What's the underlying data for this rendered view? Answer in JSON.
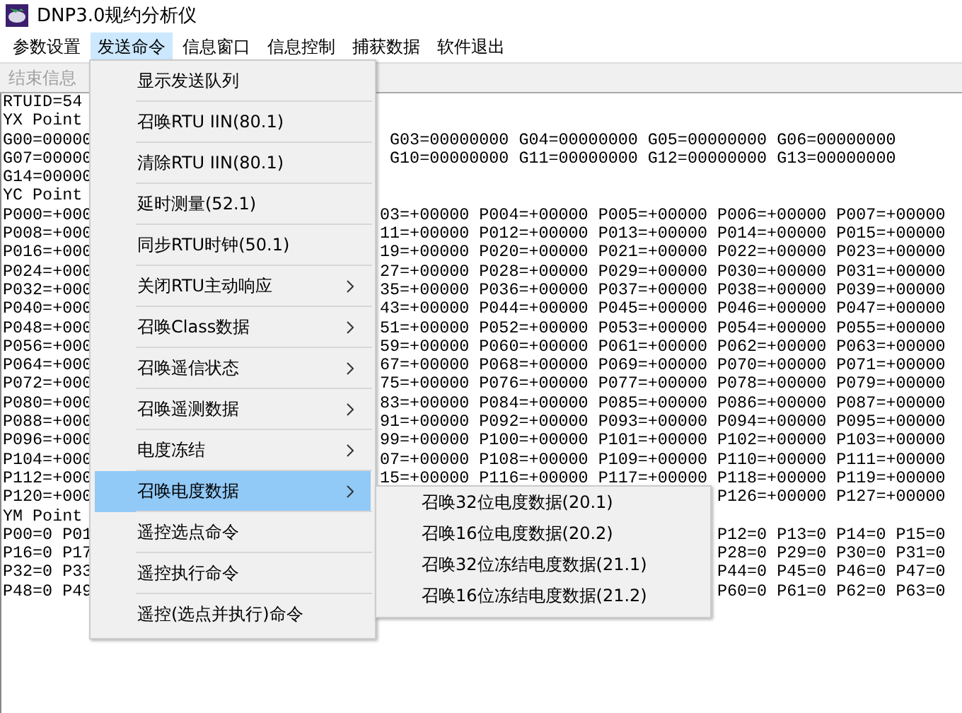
{
  "window": {
    "title": "DNP3.0规约分析仪"
  },
  "menu_bar": [
    {
      "label": "参数设置",
      "selected": false
    },
    {
      "label": "发送命令",
      "selected": true
    },
    {
      "label": "信息窗口",
      "selected": false
    },
    {
      "label": "信息控制",
      "selected": false
    },
    {
      "label": "捕获数据",
      "selected": false
    },
    {
      "label": "软件退出",
      "selected": false
    }
  ],
  "toolbar": [
    {
      "label": "结束信息",
      "disabled": true
    }
  ],
  "console_lines": [
    {
      "left": "RTUID=54"
    },
    {
      "left": "YX Point"
    },
    {
      "left": "G00=00000",
      "right": "G03=00000000 G04=00000000 G05=00000000 G06=00000000"
    },
    {
      "left": "G07=00000",
      "right": "G10=00000000 G11=00000000 G12=00000000 G13=00000000"
    },
    {
      "left": "G14=00000"
    },
    {
      "left": "YC Point"
    },
    {
      "left": "P000=+000",
      "right": "03=+00000 P004=+00000 P005=+00000 P006=+00000 P007=+00000"
    },
    {
      "left": "P008=+000",
      "right": "11=+00000 P012=+00000 P013=+00000 P014=+00000 P015=+00000"
    },
    {
      "left": "P016=+000",
      "right": "19=+00000 P020=+00000 P021=+00000 P022=+00000 P023=+00000"
    },
    {
      "left": "P024=+000",
      "right": "27=+00000 P028=+00000 P029=+00000 P030=+00000 P031=+00000"
    },
    {
      "left": "P032=+000",
      "right": "35=+00000 P036=+00000 P037=+00000 P038=+00000 P039=+00000"
    },
    {
      "left": "P040=+000",
      "right": "43=+00000 P044=+00000 P045=+00000 P046=+00000 P047=+00000"
    },
    {
      "left": "P048=+000",
      "right": "51=+00000 P052=+00000 P053=+00000 P054=+00000 P055=+00000"
    },
    {
      "left": "P056=+000",
      "right": "59=+00000 P060=+00000 P061=+00000 P062=+00000 P063=+00000"
    },
    {
      "left": "P064=+000",
      "right": "67=+00000 P068=+00000 P069=+00000 P070=+00000 P071=+00000"
    },
    {
      "left": "P072=+000",
      "right": "75=+00000 P076=+00000 P077=+00000 P078=+00000 P079=+00000"
    },
    {
      "left": "P080=+000",
      "right": "83=+00000 P084=+00000 P085=+00000 P086=+00000 P087=+00000"
    },
    {
      "left": "P088=+000",
      "right": "91=+00000 P092=+00000 P093=+00000 P094=+00000 P095=+00000"
    },
    {
      "left": "P096=+000",
      "right": "99=+00000 P100=+00000 P101=+00000 P102=+00000 P103=+00000"
    },
    {
      "left": "P104=+000",
      "right": "07=+00000 P108=+00000 P109=+00000 P110=+00000 P111=+00000"
    },
    {
      "left": "P112=+000",
      "right": "15=+00000 P116=+00000 P117=+00000 P118=+00000 P119=+00000"
    },
    {
      "left": "P120=+000",
      "right": "P126=+00000 P127=+00000"
    },
    {
      "left": "YM Point"
    },
    {
      "left": "P00=0 P01",
      "right": "P12=0 P13=0 P14=0 P15=0"
    },
    {
      "left": "P16=0 P17",
      "right": "P28=0 P29=0 P30=0 P31=0"
    },
    {
      "left": "P32=0 P33",
      "right": "P44=0 P45=0 P46=0 P47=0"
    },
    {
      "left": "P48=0 P49",
      "right": "P60=0 P61=0 P62=0 P63=0"
    }
  ],
  "dropdown_menu": [
    {
      "label": "显示发送队列",
      "has_submenu": false,
      "selected": false
    },
    {
      "label": "召唤RTU IIN(80.1)",
      "has_submenu": false,
      "selected": false
    },
    {
      "label": "清除RTU IIN(80.1)",
      "has_submenu": false,
      "selected": false
    },
    {
      "label": "延时测量(52.1)",
      "has_submenu": false,
      "selected": false
    },
    {
      "label": "同步RTU时钟(50.1)",
      "has_submenu": false,
      "selected": false
    },
    {
      "label": "关闭RTU主动响应",
      "has_submenu": true,
      "selected": false
    },
    {
      "label": "召唤Class数据",
      "has_submenu": true,
      "selected": false
    },
    {
      "label": "召唤遥信状态",
      "has_submenu": true,
      "selected": false
    },
    {
      "label": "召唤遥测数据",
      "has_submenu": true,
      "selected": false
    },
    {
      "label": "电度冻结",
      "has_submenu": true,
      "selected": false
    },
    {
      "label": "召唤电度数据",
      "has_submenu": true,
      "selected": true
    },
    {
      "label": "遥控选点命令",
      "has_submenu": false,
      "selected": false
    },
    {
      "label": "遥控执行命令",
      "has_submenu": false,
      "selected": false
    },
    {
      "label": "遥控(选点并执行)命令",
      "has_submenu": false,
      "selected": false
    }
  ],
  "submenu": [
    {
      "label": "召唤32位电度数据(20.1)"
    },
    {
      "label": "召唤16位电度数据(20.2)"
    },
    {
      "label": "召唤32位冻结电度数据(21.1)"
    },
    {
      "label": "召唤16位冻结电度数据(21.2)"
    }
  ]
}
